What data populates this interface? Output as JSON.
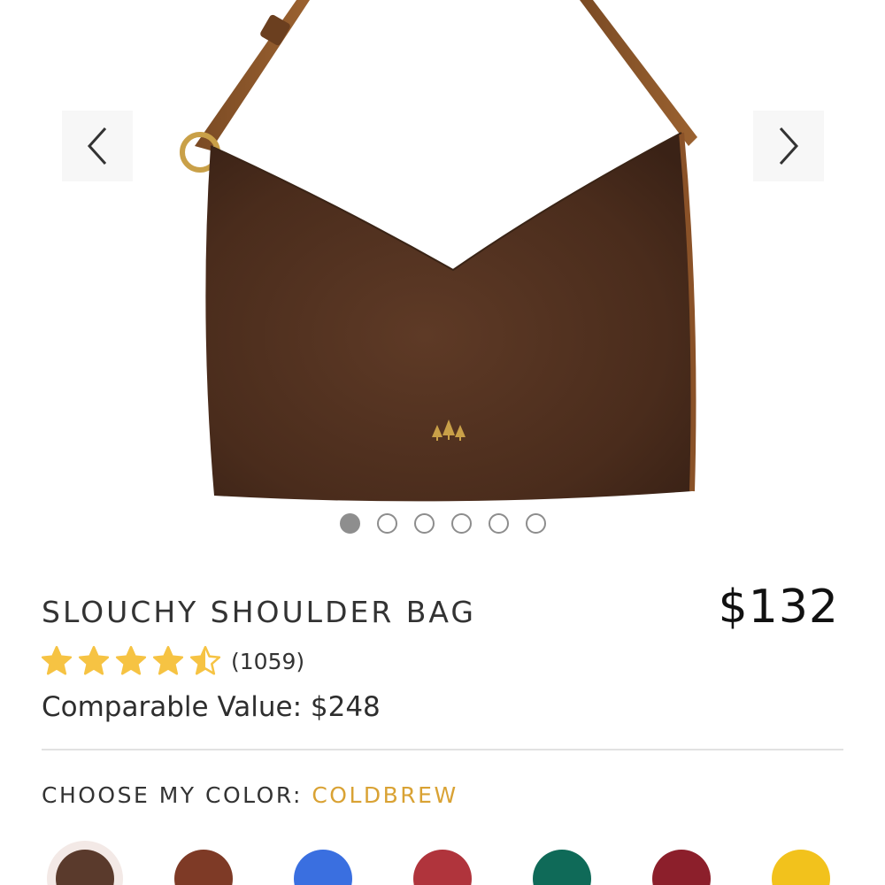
{
  "gallery": {
    "prev_label": "Previous image",
    "next_label": "Next image",
    "image_alt": "Slouchy Shoulder Bag in Coldbrew",
    "slides": [
      {
        "active": true
      },
      {
        "active": false
      },
      {
        "active": false
      },
      {
        "active": false
      },
      {
        "active": false
      },
      {
        "active": false
      }
    ]
  },
  "product": {
    "title": "SLOUCHY SHOULDER BAG",
    "price": "$132",
    "rating": 4.5,
    "review_count": "(1059)",
    "comparable_value": "Comparable Value: $248"
  },
  "color_picker": {
    "label": "CHOOSE MY COLOR: ",
    "selected": "COLDBREW",
    "swatches": [
      {
        "color": "#5a3a2c",
        "selected": true
      },
      {
        "color": "#7e3a26"
      },
      {
        "color": "#3a6fe0"
      },
      {
        "color": "#b0343c"
      },
      {
        "color": "#0f6a58"
      },
      {
        "color": "#8c1f2b"
      },
      {
        "color": "#f2c21c"
      }
    ]
  },
  "colors": {
    "accent": "#d9a234",
    "star": "#f6c343"
  }
}
